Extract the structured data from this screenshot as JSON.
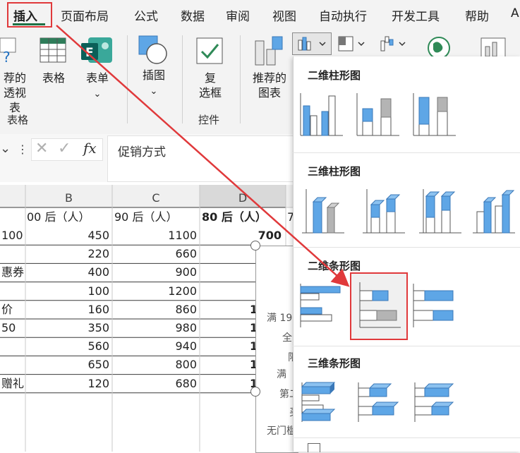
{
  "menu": {
    "items": [
      "插入",
      "页面布局",
      "公式",
      "数据",
      "审阅",
      "视图",
      "自动执行",
      "开发工具",
      "帮助",
      "A"
    ]
  },
  "ribbon": {
    "pivot_label_line1": "荐的",
    "pivot_label_line2": "透视表",
    "table_label": "表格",
    "form_label": "表单",
    "form_caret": "⌄",
    "illustrations_label": "插图",
    "illustrations_caret": "⌄",
    "checkbox_label_line1": "复",
    "checkbox_label_line2": "选框",
    "recommended_charts_line1": "推荐的",
    "recommended_charts_line2": "图表",
    "group_tables": "表格",
    "group_controls": "控件"
  },
  "formula_bar": {
    "fx": "fx",
    "value": "促销方式"
  },
  "sheet": {
    "col_headers": [
      "B",
      "C",
      "D"
    ],
    "header_row": [
      "00 后（人）",
      "90 后（人）",
      "80 后（人）",
      "7"
    ],
    "col_a": [
      "100",
      "",
      "惠券",
      "",
      "价",
      "50",
      "",
      "",
      "赠礼"
    ],
    "col_b": [
      "450",
      "220",
      "400",
      "100",
      "160",
      "350",
      "560",
      "650",
      "120"
    ],
    "col_c": [
      "1100",
      "660",
      "900",
      "1200",
      "860",
      "980",
      "940",
      "800",
      "680"
    ],
    "col_d_first": "700",
    "col_d_partial": [
      "1",
      "1",
      "1",
      "1",
      "1"
    ],
    "chart_labels": [
      "满 19",
      "全",
      "限",
      "满",
      "第二",
      "买",
      "无门槛"
    ]
  },
  "dropdown": {
    "section_2d_column": "二维柱形图",
    "section_3d_column": "三维柱形图",
    "section_2d_bar": "二维条形图",
    "section_3d_bar": "三维条形图"
  },
  "colors": {
    "accent_red": "#e0393b",
    "bar_blue": "#5ea6e6",
    "bar_gray": "#b4b4b4",
    "excel_green": "#1e7145"
  }
}
